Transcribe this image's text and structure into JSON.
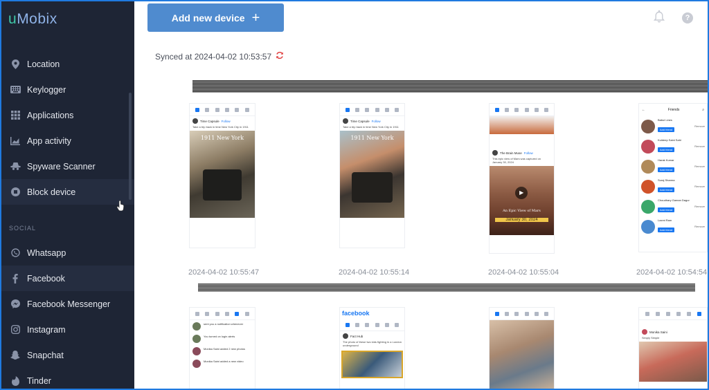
{
  "app": {
    "logo_u": "u",
    "logo_rest": "Mobix"
  },
  "sidebar": {
    "items": [
      {
        "label": "Location",
        "icon": "location-pin-icon"
      },
      {
        "label": "Keylogger",
        "icon": "keyboard-icon"
      },
      {
        "label": "Applications",
        "icon": "grid-icon"
      },
      {
        "label": "App activity",
        "icon": "chart-icon"
      },
      {
        "label": "Spyware Scanner",
        "icon": "spy-hat-icon"
      },
      {
        "label": "Block device",
        "icon": "block-icon"
      }
    ],
    "section_social": "SOCIAL",
    "social_items": [
      {
        "label": "Whatsapp",
        "icon": "whatsapp-icon"
      },
      {
        "label": "Facebook",
        "icon": "facebook-icon"
      },
      {
        "label": "Facebook Messenger",
        "icon": "messenger-icon"
      },
      {
        "label": "Instagram",
        "icon": "instagram-icon"
      },
      {
        "label": "Snapchat",
        "icon": "snapchat-icon"
      },
      {
        "label": "Tinder",
        "icon": "tinder-flame-icon"
      }
    ]
  },
  "header": {
    "add_device_label": "Add new device",
    "synced_text": "Synced at 2024-04-02 10:53:57"
  },
  "screenshots": {
    "row1": [
      {
        "timestamp": "2024-04-02 10:55:47",
        "post_name": "Time Capsule",
        "follow": "Follow",
        "caption": "Take a trip back in time New York City in 1911",
        "photo_title": "1911 New York"
      },
      {
        "timestamp": "2024-04-02 10:55:14",
        "post_name": "Time Capsule",
        "follow": "Follow",
        "caption": "Take a trip back in time New York City in 1911",
        "photo_title": "1911 New York"
      },
      {
        "timestamp": "2024-04-02 10:55:04",
        "post_name": "The Brain Muse",
        "follow": "Follow",
        "caption": "This epic view of Mars was captured on January 30, 2024",
        "photo_caption": "An Epic View of Mars",
        "photo_date": "January 30, 2024"
      },
      {
        "timestamp": "2024-04-02 10:54:54",
        "header": "Friends",
        "friends": [
          "Babul Lines",
          "Kuldeep Saini Sahi",
          "Harak Kumar",
          "Suraj Sharma",
          "Choudhary Gaman Dagur",
          "Laxmi Ram"
        ],
        "add_label": "Add friend",
        "remove_label": "Remove"
      }
    ],
    "row2": [
      {
        "kind": "notifications",
        "lines": [
          "sent you a notification whenever",
          "You turned on login alerts",
          "Monika Saini added 2 new photos",
          "Monika Saini added a new video"
        ]
      },
      {
        "kind": "feed",
        "logo": "facebook",
        "post_name": "Fact Hub",
        "caption": "The photo of these two kids fighting in a London underground"
      },
      {
        "kind": "photo"
      },
      {
        "kind": "profile",
        "post_name": "Monika Saini",
        "caption": "Simply Simple"
      }
    ]
  }
}
